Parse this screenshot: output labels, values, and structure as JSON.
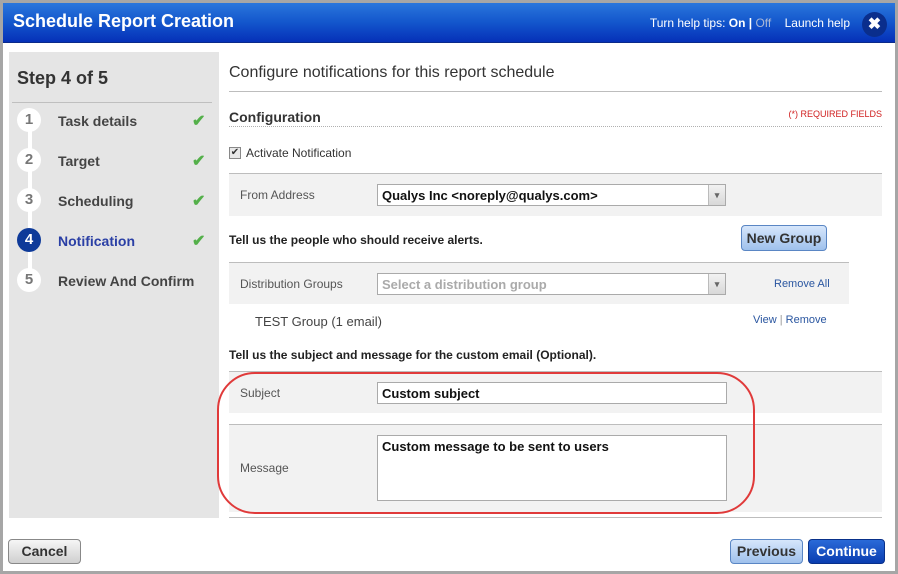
{
  "window": {
    "title": "Schedule Report Creation",
    "help_tips_label": "Turn help tips:",
    "help_on": "On",
    "help_separator": "|",
    "help_off": "Off",
    "launch_help": "Launch help",
    "close_icon": "✖"
  },
  "sidebar": {
    "step_header": "Step 4 of 5",
    "steps": [
      {
        "num": "1",
        "label": "Task details",
        "done": true
      },
      {
        "num": "2",
        "label": "Target",
        "done": true
      },
      {
        "num": "3",
        "label": "Scheduling",
        "done": true
      },
      {
        "num": "4",
        "label": "Notification",
        "done": true,
        "active": true
      },
      {
        "num": "5",
        "label": "Review And Confirm",
        "done": false
      }
    ],
    "check_glyph": "✔"
  },
  "main": {
    "heading": "Configure notifications for this report schedule",
    "section_title": "Configuration",
    "required_fields": "(*) REQUIRED FIELDS",
    "activate_notification": {
      "label": "Activate Notification",
      "checked": true,
      "glyph": "✔"
    },
    "from_address": {
      "label": "From Address",
      "value": "Qualys Inc <noreply@qualys.com>"
    },
    "recipients_instruction": "Tell us the people who should receive alerts.",
    "new_group_button": "New Group",
    "distribution_groups": {
      "label": "Distribution Groups",
      "placeholder": "Select a distribution group",
      "remove_all": "Remove All"
    },
    "selected_group": {
      "name": "TEST Group (1 email)",
      "view": "View",
      "separator": "|",
      "remove": "Remove"
    },
    "custom_email_instruction": "Tell us the subject and message for the custom email (Optional).",
    "subject": {
      "label": "Subject",
      "value": "Custom subject"
    },
    "message": {
      "label": "Message",
      "value": "Custom message to be sent to users"
    },
    "dropdown_arrow": "▾"
  },
  "footer": {
    "cancel": "Cancel",
    "previous": "Previous",
    "continue": "Continue"
  },
  "colors": {
    "titlebar": "#1356cc",
    "active_step": "#0e3a99",
    "check": "#54b04a",
    "required": "#d02020",
    "highlight": "#e03a3a"
  }
}
